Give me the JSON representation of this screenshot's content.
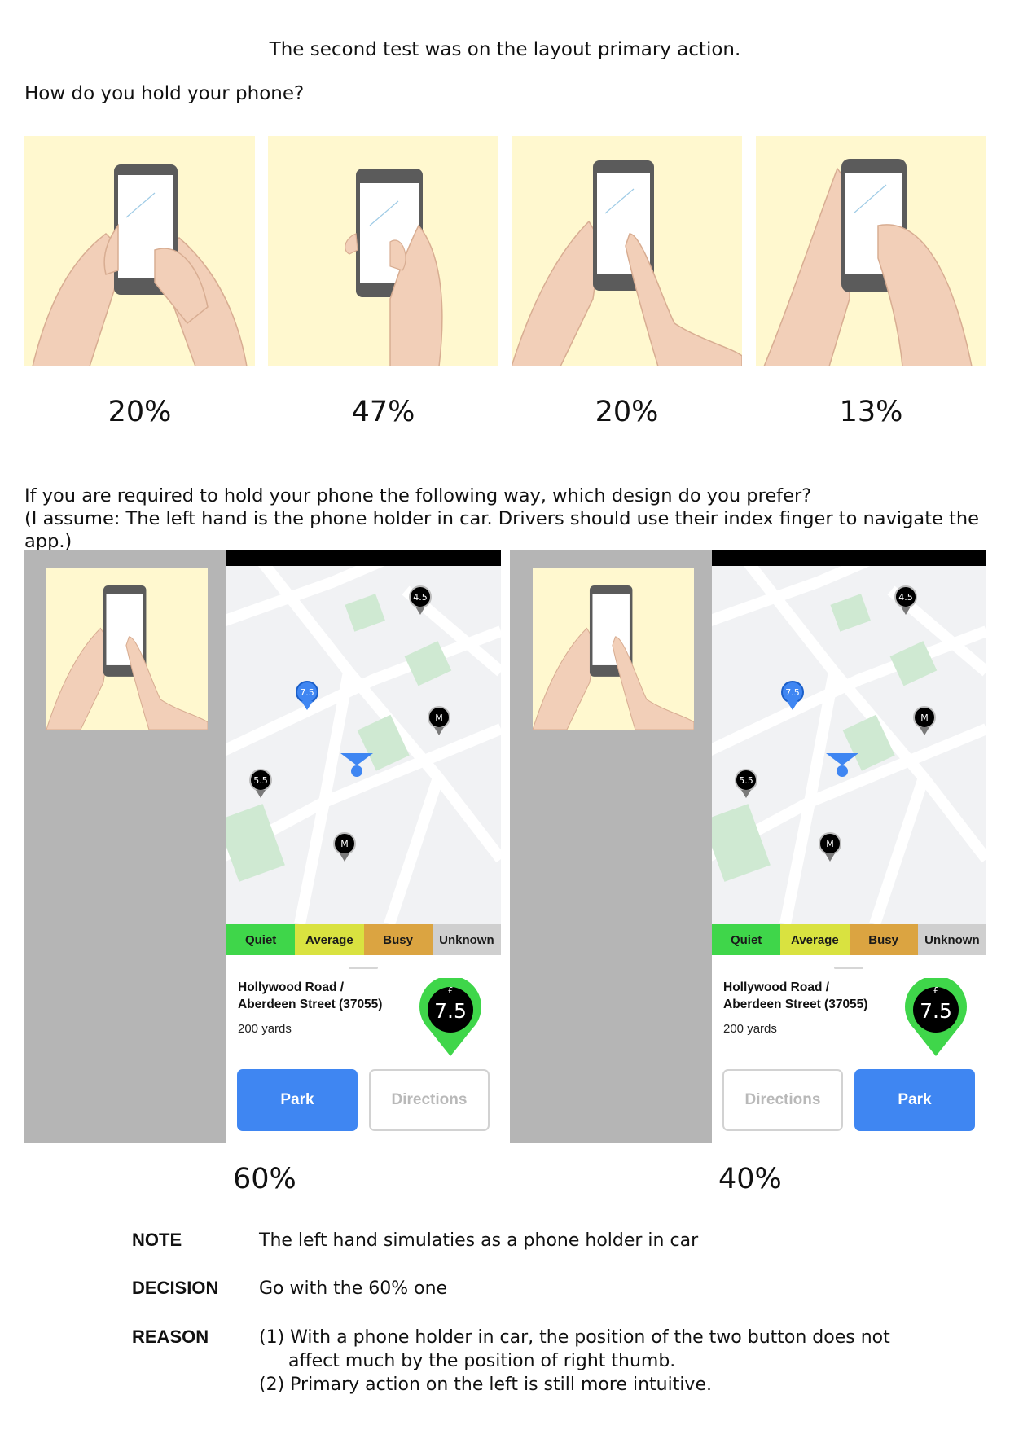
{
  "heading": "The second test was on the layout primary action.",
  "question1": "How do you hold your phone?",
  "holding_results": [
    {
      "percent": "20%"
    },
    {
      "percent": "47%"
    },
    {
      "percent": "20%"
    },
    {
      "percent": "13%"
    }
  ],
  "question2": {
    "line1": "If you are required to hold your phone the following way, which design do you prefer?",
    "line2": "(I assume: The left hand is the phone holder in car. Drivers should use their index finger to navigate the app.)"
  },
  "legend": [
    "Quiet",
    "Average",
    "Busy",
    "Unknown"
  ],
  "legend_colors": {
    "quiet": "#3fd64a",
    "average": "#d9e240",
    "busy": "#dba441",
    "unknown": "#cfcfcf"
  },
  "map_pins": [
    "4.5",
    "7.5",
    "M",
    "5.5",
    "M"
  ],
  "location": {
    "address_line1": "Hollywood Road /",
    "address_line2": "Aberdeen Street (37055)",
    "distance": "200 yards",
    "currency": "£",
    "price": "7.5"
  },
  "design_a": {
    "primary": "Park",
    "secondary": "Directions",
    "result": "60%"
  },
  "design_b": {
    "primary": "Park",
    "secondary": "Directions",
    "result": "40%"
  },
  "notes": {
    "note_label": "NOTE",
    "note_text": "The left hand simulaties as a phone holder in car",
    "decision_label": "DECISION",
    "decision_text": "Go with the 60% one",
    "reason_label": "REASON",
    "reason_1a": "(1) With a phone holder in car, the position of the two button does not",
    "reason_1b": "affect much by the position of right thumb.",
    "reason_2": "(2) Primary action on the left is still more intuitive."
  },
  "colors": {
    "primary_button": "#3f86f2",
    "photo_background": "#fff8cf",
    "panel_grey": "#b5b5b5"
  }
}
